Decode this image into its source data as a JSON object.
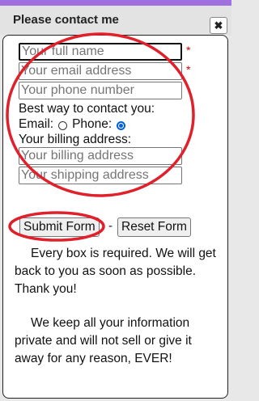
{
  "dialog": {
    "title": "Please contact me",
    "close_symbol": "✖"
  },
  "form": {
    "name_placeholder": "Your full name",
    "email_placeholder": "Your email address",
    "phone_placeholder": "Your phone number",
    "required_marker": "*",
    "contact_prompt": "Best way to contact you:",
    "email_option": "Email:",
    "phone_option": "Phone:",
    "selected_contact": "Phone",
    "billing_label": "Your billing address:",
    "billing_placeholder": "Your billing address",
    "shipping_placeholder": "Your shipping address",
    "submit_label": "Submit Form",
    "separator": "-",
    "reset_label": "Reset Form"
  },
  "notes": {
    "required_notice": "Every box is required. We will get back to you as soon as possible. Thank you!",
    "privacy_notice": "We keep all your information private and will not sell or give it away for any reason, EVER!"
  },
  "annotation_color": "#e0202a"
}
